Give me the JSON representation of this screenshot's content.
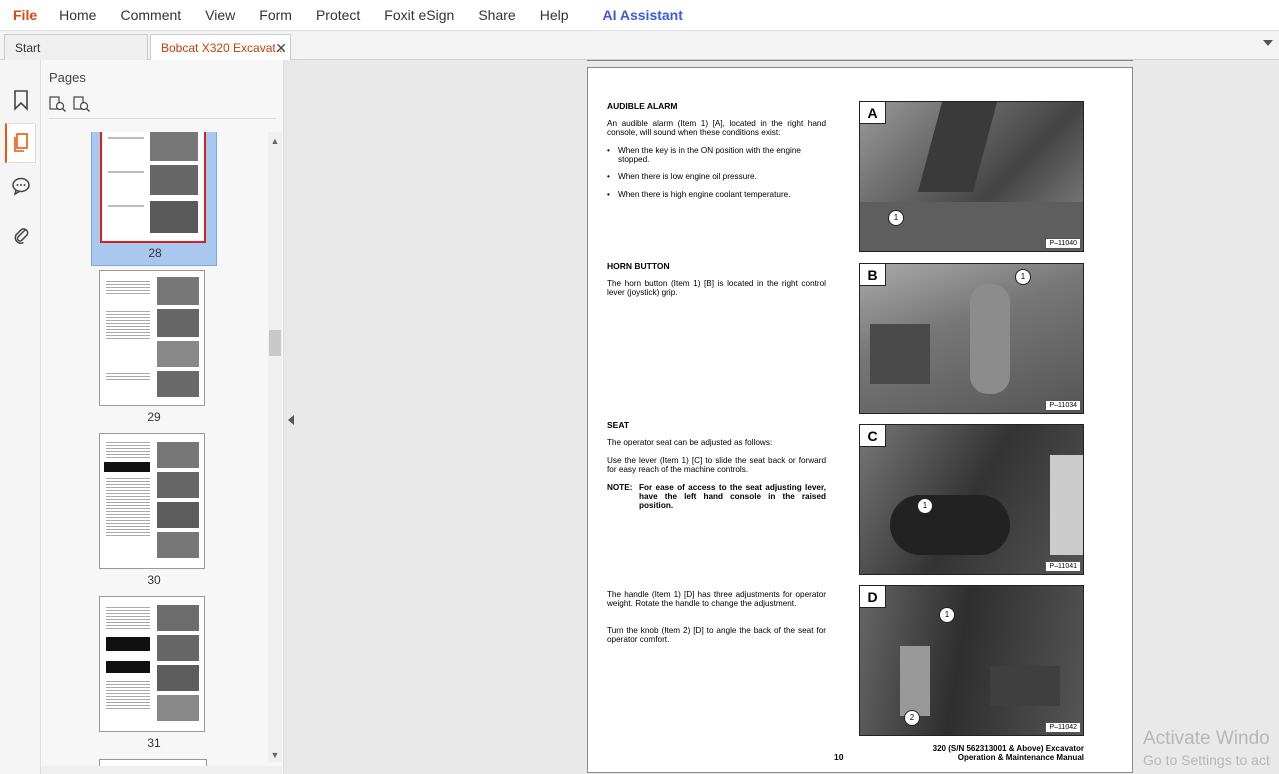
{
  "menu": {
    "items": [
      "File",
      "Home",
      "Comment",
      "View",
      "Form",
      "Protect",
      "Foxit eSign",
      "Share",
      "Help",
      "AI Assistant"
    ]
  },
  "tabs": {
    "start": "Start",
    "doc": "Bobcat X320 Excavat..."
  },
  "panel": {
    "title": "Pages",
    "thumbnails": [
      {
        "page": "28",
        "selected": true
      },
      {
        "page": "29",
        "selected": false
      },
      {
        "page": "30",
        "selected": false
      },
      {
        "page": "31",
        "selected": false
      }
    ]
  },
  "page": {
    "sections": {
      "alarm_title": "AUDIBLE ALARM",
      "alarm_para": "An audible alarm (Item 1) [A], located in the right hand console, will sound when these conditions exist:",
      "alarm_bullets": [
        "When the key is in the ON position with the engine stopped.",
        "When there is low engine oil pressure.",
        "When there is high engine coolant temperature."
      ],
      "horn_title": "HORN BUTTON",
      "horn_para": "The horn button (Item 1) [B] is located in the right control lever (joystick) grip.",
      "seat_title": "SEAT",
      "seat_para1": "The operator seat can be adjusted as follows:",
      "seat_para2": "Use the lever (Item 1) [C] to slide the seat back or forward for easy reach of the machine controls.",
      "note_label": "NOTE:",
      "note_text": "For ease of access to the seat adjusting lever, have the left hand console in the raised position.",
      "handle_para1": "The handle (Item 1) [D] has three adjustments for operator weight. Rotate the handle to change the adjustment.",
      "handle_para2": "Turn the knob (Item 2) [D] to angle the back of the seat for operator comfort."
    },
    "figures": [
      {
        "letter": "A",
        "code": "P–11040"
      },
      {
        "letter": "B",
        "code": "P–11034"
      },
      {
        "letter": "C",
        "code": "P–11041"
      },
      {
        "letter": "D",
        "code": "P–11042"
      }
    ],
    "callouts": {
      "one": "1",
      "two": "2"
    },
    "page_number": "10",
    "footer_line1": "320 (S/N 562313001 & Above) Excavator",
    "footer_line2": "Operation & Maintenance Manual"
  },
  "watermark": {
    "line1": "Activate Windo",
    "line2": "Go to Settings to act"
  },
  "colors": {
    "accent": "#d9480f",
    "ai": "#3b5bdb",
    "selection": "#a9c8ef"
  },
  "icons": [
    "bookmark-icon",
    "pages-icon",
    "comment-icon",
    "attachment-icon",
    "thumbnail-zoom-in-icon",
    "thumbnail-zoom-out-icon"
  ]
}
